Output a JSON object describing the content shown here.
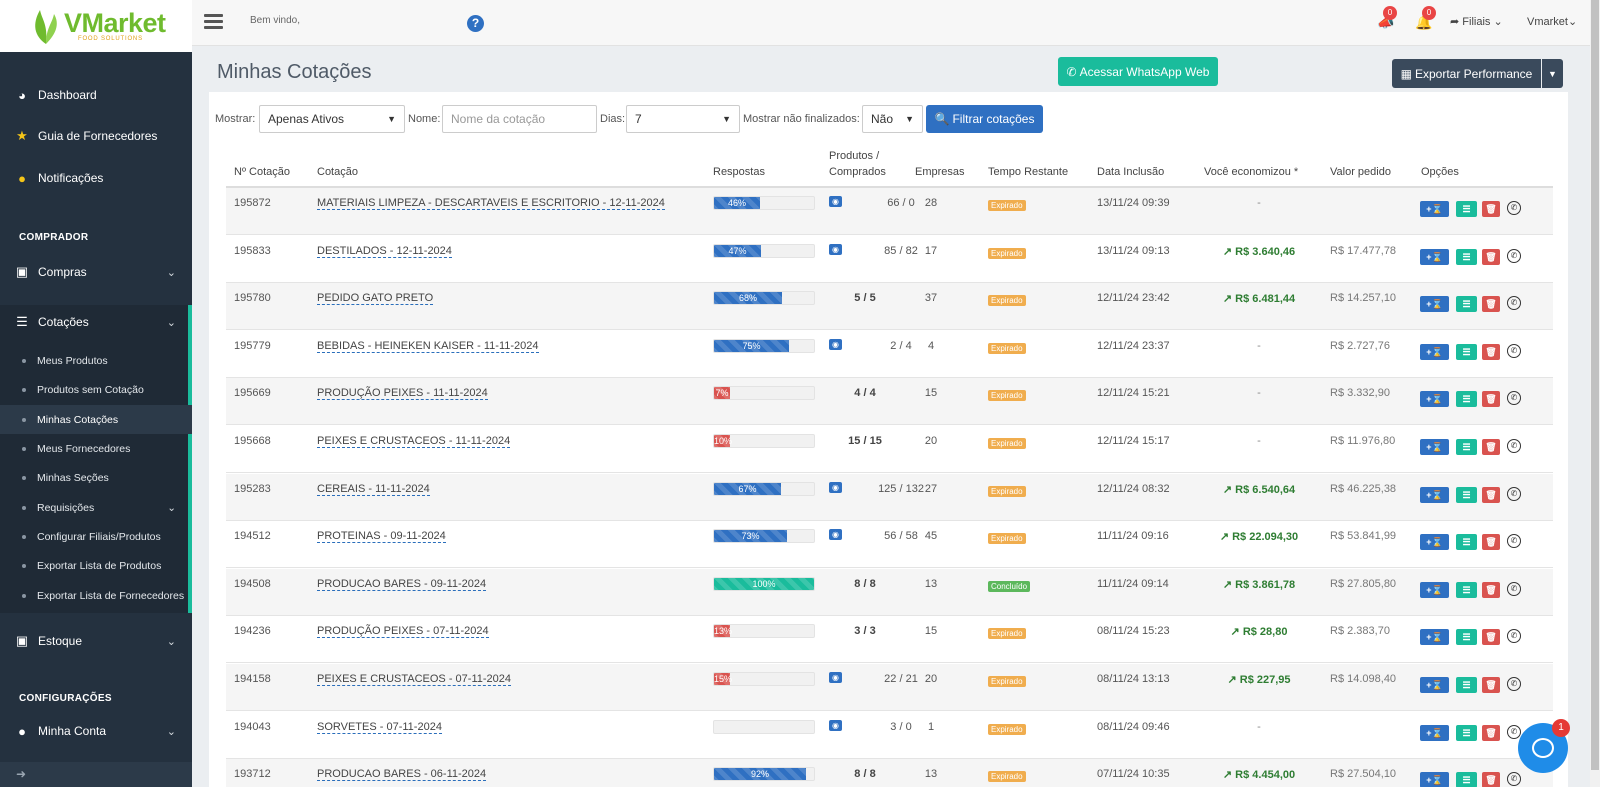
{
  "brand": {
    "logo_text": "VMarket",
    "logo_sub": "FOOD SOLUTIONS"
  },
  "topbar": {
    "welcome": "Bem vindo,",
    "help": "?",
    "cart_badge": "0",
    "bell_badge": "0",
    "filiais": "Filiais",
    "user": "Vmarket"
  },
  "sidebar": {
    "dashboard": "Dashboard",
    "guia": "Guia de Fornecedores",
    "notificacoes": "Notificações",
    "sec_comprador": "COMPRADOR",
    "compras": "Compras",
    "cotacoes": "Cotações",
    "sub": [
      "Meus Produtos",
      "Produtos sem Cotação",
      "Minhas Cotações",
      "Meus Fornecedores",
      "Minhas Seções",
      "Requisições",
      "Configurar Filiais/Produtos",
      "Exportar Lista de Produtos",
      "Exportar Lista de Fornecedores"
    ],
    "estoque": "Estoque",
    "sec_config": "CONFIGURAÇÕES",
    "minha_conta": "Minha Conta"
  },
  "page": {
    "title": "Minhas Cotações",
    "whatsapp_btn": "Acessar WhatsApp Web",
    "export_btn": "Exportar Performance"
  },
  "filters": {
    "mostrar_label": "Mostrar:",
    "mostrar_value": "Apenas Ativos",
    "nome_label": "Nome:",
    "nome_placeholder": "Nome da cotação",
    "dias_label": "Dias:",
    "dias_value": "7",
    "naofin_label": "Mostrar não finalizados:",
    "naofin_value": "Não",
    "filter_btn": "Filtrar cotações"
  },
  "table": {
    "headers": [
      "Nº Cotação",
      "Cotação",
      "Respostas",
      "Produtos /",
      "Comprados",
      "Empresas",
      "Tempo Restante",
      "Data Inclusão",
      "Você economizou *",
      "Valor pedido",
      "Opções"
    ],
    "rows": [
      {
        "num": "195872",
        "name": "MATERIAIS LIMPEZA - DESCARTAVEIS E ESCRITORIO - 12-11-2024",
        "pct": "46%",
        "prod": "66 / 0",
        "bold": false,
        "eye": true,
        "emp": "28",
        "status": "Expirado",
        "data": "13/11/24 09:39",
        "eco": "-",
        "valor": ""
      },
      {
        "num": "195833",
        "name": "DESTILADOS - 12-11-2024",
        "pct": "47%",
        "prod": "85 / 82",
        "bold": false,
        "eye": true,
        "emp": "17",
        "status": "Expirado",
        "data": "13/11/24 09:13",
        "eco": "R$ 3.640,46",
        "valor": "R$ 17.477,78"
      },
      {
        "num": "195780",
        "name": "PEDIDO GATO PRETO",
        "pct": "68%",
        "prod": "5 / 5",
        "bold": true,
        "eye": false,
        "emp": "37",
        "status": "Expirado",
        "data": "12/11/24 23:42",
        "eco": "R$ 6.481,44",
        "valor": "R$ 14.257,10"
      },
      {
        "num": "195779",
        "name": "BEBIDAS - HEINEKEN KAISER - 11-11-2024",
        "pct": "75%",
        "prod": "2 / 4",
        "bold": false,
        "eye": true,
        "emp": "4",
        "status": "Expirado",
        "data": "12/11/24 23:37",
        "eco": "-",
        "valor": "R$ 2.727,76"
      },
      {
        "num": "195669",
        "name": "PRODUÇÃO PEIXES - 11-11-2024",
        "pct": "7%",
        "prod": "4 / 4",
        "bold": true,
        "eye": false,
        "emp": "15",
        "status": "Expirado",
        "data": "12/11/24 15:21",
        "eco": "-",
        "valor": "R$ 3.332,90"
      },
      {
        "num": "195668",
        "name": "PEIXES E CRUSTACEOS - 11-11-2024",
        "pct": "10%",
        "prod": "15 / 15",
        "bold": true,
        "eye": false,
        "emp": "20",
        "status": "Expirado",
        "data": "12/11/24 15:17",
        "eco": "-",
        "valor": "R$ 11.976,80"
      },
      {
        "num": "195283",
        "name": "CEREAIS - 11-11-2024",
        "pct": "67%",
        "prod": "125 / 132",
        "bold": false,
        "eye": true,
        "emp": "27",
        "status": "Expirado",
        "data": "12/11/24 08:32",
        "eco": "R$ 6.540,64",
        "valor": "R$ 46.225,38"
      },
      {
        "num": "194512",
        "name": "PROTEINAS - 09-11-2024",
        "pct": "73%",
        "prod": "56 / 58",
        "bold": false,
        "eye": true,
        "emp": "45",
        "status": "Expirado",
        "data": "11/11/24 09:16",
        "eco": "R$ 22.094,30",
        "valor": "R$ 53.841,99"
      },
      {
        "num": "194508",
        "name": "PRODUCAO BARES - 09-11-2024",
        "pct": "100%",
        "prod": "8 / 8",
        "bold": true,
        "eye": false,
        "emp": "13",
        "status": "Concluído",
        "data": "11/11/24 09:14",
        "eco": "R$ 3.861,78",
        "valor": "R$ 27.805,80"
      },
      {
        "num": "194236",
        "name": "PRODUÇÃO PEIXES - 07-11-2024",
        "pct": "13%",
        "prod": "3 / 3",
        "bold": true,
        "eye": false,
        "emp": "15",
        "status": "Expirado",
        "data": "08/11/24 15:23",
        "eco": "R$ 28,80",
        "valor": "R$ 2.383,70"
      },
      {
        "num": "194158",
        "name": "PEIXES E CRUSTACEOS - 07-11-2024",
        "pct": "15%",
        "prod": "22 / 21",
        "bold": false,
        "eye": true,
        "emp": "20",
        "status": "Expirado",
        "data": "08/11/24 13:13",
        "eco": "R$ 227,95",
        "valor": "R$ 14.098,40"
      },
      {
        "num": "194043",
        "name": "SORVETES - 07-11-2024",
        "pct": "",
        "prod": "3 / 0",
        "bold": false,
        "eye": true,
        "emp": "1",
        "status": "Expirado",
        "data": "08/11/24 09:46",
        "eco": "-",
        "valor": ""
      },
      {
        "num": "193712",
        "name": "PRODUCAO BARES - 06-11-2024",
        "pct": "92%",
        "prod": "8 / 8",
        "bold": true,
        "eye": false,
        "emp": "13",
        "status": "Expirado",
        "data": "07/11/24 10:35",
        "eco": "R$ 4.454,00",
        "valor": "R$ 27.504,10"
      }
    ]
  },
  "chat": {
    "badge": "1"
  },
  "colors": {
    "sidebar": "#24313f",
    "accent": "#1abc9c",
    "primary": "#2f70c2",
    "danger": "#d9534f",
    "warning": "#f0ad4e",
    "success": "#5cb85c"
  }
}
